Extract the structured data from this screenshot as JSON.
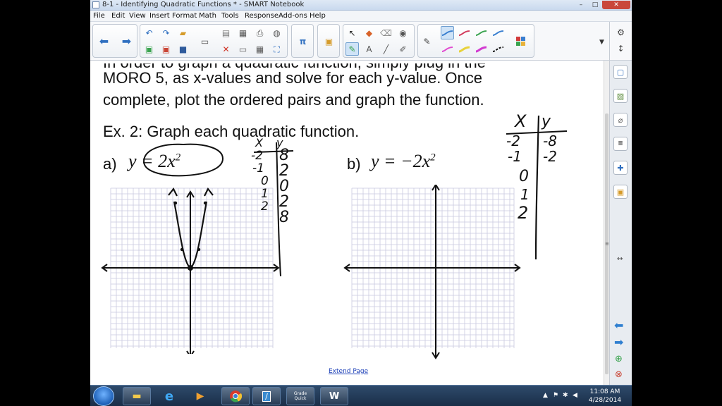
{
  "window": {
    "title": "8-1 - Identifying Quadratic Functions * - SMART Notebook",
    "controls": {
      "minimize": "–",
      "maximize": "□",
      "close": "✕"
    }
  },
  "menu": [
    "File",
    "Edit",
    "View",
    "Insert",
    "Format",
    "Math",
    "Tools",
    "Response",
    "Add-ons",
    "Help"
  ],
  "toolbar": {
    "icons": [
      "back-arrow-icon",
      "forward-arrow-icon",
      "undo-icon",
      "redo-icon",
      "open-icon",
      "save-icon",
      "paste-icon",
      "delete-icon",
      "screen-shade-icon",
      "table-icon",
      "full-screen-icon",
      "math-icon",
      "response-icon",
      "select-icon",
      "pen-icon",
      "eraser-icon",
      "line-icon",
      "shape-icon",
      "fill-icon",
      "magic-pen-icon",
      "color-palette-icon"
    ],
    "pen_colors": [
      "#3a7fd0",
      "#d23b5c",
      "#3aa34f",
      "#3a7fd0",
      "#e04ad0",
      "#e8d23a",
      "#d23bd0",
      "#111111"
    ]
  },
  "page": {
    "line1": "In order to graph a quadratic function, simply plug in the",
    "line2": "MORO 5, as x-values and solve for each y-value.  Once",
    "line3": "complete, plot the ordered pairs and graph the function.",
    "example": "Ex. 2: Graph each quadratic function.",
    "part_a_label": "a)",
    "part_a_eq": "y = 2x",
    "part_a_exp": "2",
    "part_b_label": "b)",
    "part_b_eq": "y = −2x",
    "part_b_exp": "2",
    "table_a_x": [
      "-2",
      "-1",
      "0",
      "1",
      "2"
    ],
    "table_a_y": [
      "8",
      "2",
      "0",
      "2",
      "8"
    ],
    "table_b_x": [
      "-2",
      "-1",
      "0",
      "1",
      "2"
    ],
    "table_b_y": [
      "-8",
      "-2",
      "",
      "",
      ""
    ],
    "table_header_x": "X",
    "table_header_y": "y",
    "extend_link": "Extend Page"
  },
  "side_tabs": [
    "page-sorter-icon",
    "gallery-icon",
    "attachments-icon",
    "properties-icon",
    "add-ons-icon",
    "response-icon",
    "prev-page-icon",
    "next-page-icon",
    "add-page-icon",
    "delete-page-icon"
  ],
  "taskbar": {
    "apps": [
      "file-explorer-icon",
      "internet-explorer-icon",
      "media-player-icon",
      "chrome-icon",
      "smart-notebook-icon",
      "grade-quick-icon",
      "word-icon"
    ],
    "grade_quick_label": "Grade Quick",
    "time": "11:08 AM",
    "date": "4/28/2014"
  }
}
